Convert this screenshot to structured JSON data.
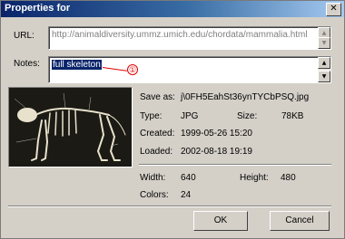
{
  "window": {
    "title": "Properties for"
  },
  "url": {
    "label": "URL:",
    "value": "http://animaldiversity.ummz.umich.edu/chordata/mammalia.html"
  },
  "notes": {
    "label": "Notes:",
    "value": "full skeleton",
    "annotation": "①"
  },
  "image": {
    "description_icon": "skeleton-image"
  },
  "info": {
    "save_as_label": "Save as:",
    "save_as_value": "j\\0FH5EahSt36ynTYCbPSQ.jpg",
    "type_label": "Type:",
    "type_value": "JPG",
    "size_label": "Size:",
    "size_value": "78KB",
    "created_label": "Created:",
    "created_value": "1999-05-26 15:20",
    "loaded_label": "Loaded:",
    "loaded_value": "2002-08-18 19:19",
    "width_label": "Width:",
    "width_value": "640",
    "height_label": "Height:",
    "height_value": "480",
    "colors_label": "Colors:",
    "colors_value": "24"
  },
  "buttons": {
    "ok": "OK",
    "cancel": "Cancel"
  },
  "colors": {
    "titlebar": "#0a246a",
    "annotation": "#e00000"
  }
}
